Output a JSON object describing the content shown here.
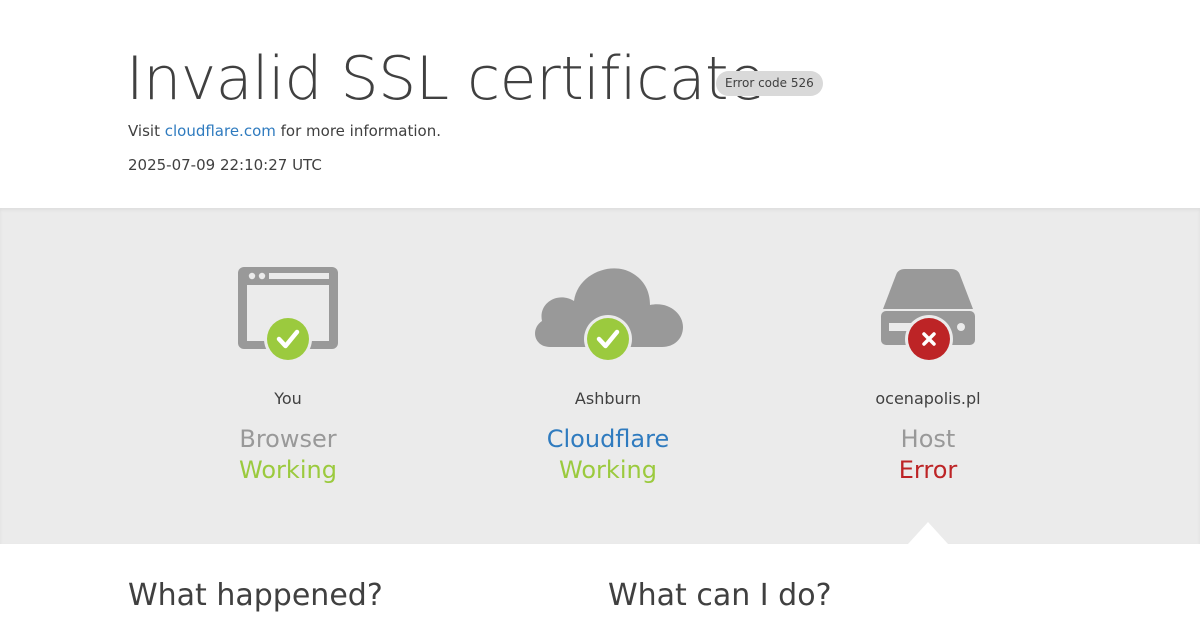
{
  "header": {
    "title": "Invalid SSL certificate",
    "error_badge": "Error code 526",
    "visit_prefix": "Visit ",
    "visit_link": "cloudflare.com",
    "visit_suffix": " for more information.",
    "timestamp": "2025-07-09 22:10:27 UTC"
  },
  "colors": {
    "ok": "#9bca3e",
    "error": "#bd2426",
    "link": "#2f7bbf",
    "icon_gray": "#999999"
  },
  "nodes": [
    {
      "icon": "browser-icon",
      "location": "You",
      "name": "Browser",
      "status": "Working",
      "state": "ok"
    },
    {
      "icon": "cloud-icon",
      "location": "Ashburn",
      "name": "Cloudflare",
      "status": "Working",
      "state": "ok"
    },
    {
      "icon": "server-icon",
      "location": "ocenapolis.pl",
      "name": "Host",
      "status": "Error",
      "state": "error"
    }
  ],
  "sections": {
    "what_happened": "What happened?",
    "what_can_i_do": "What can I do?"
  }
}
